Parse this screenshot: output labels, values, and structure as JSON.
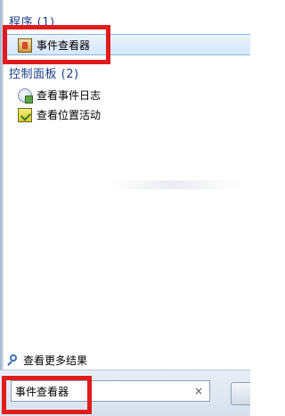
{
  "results": {
    "programs_header": "程序 (1)",
    "programs": [
      {
        "label": "事件查看器",
        "icon": "event-viewer-icon",
        "selected": true
      }
    ],
    "control_panel_header": "控制面板 (2)",
    "control_panel": [
      {
        "label": "查看事件日志",
        "icon": "event-log-icon"
      },
      {
        "label": "查看位置活动",
        "icon": "location-activity-icon"
      }
    ],
    "see_more": "查看更多结果"
  },
  "search": {
    "value": "事件查看器",
    "clear_glyph": "×"
  },
  "colors": {
    "header_text": "#1c3f8a",
    "selection_fill": "#d5e7fb",
    "selection_border": "#8fb8e6",
    "annotation_red": "#e01b1b"
  }
}
